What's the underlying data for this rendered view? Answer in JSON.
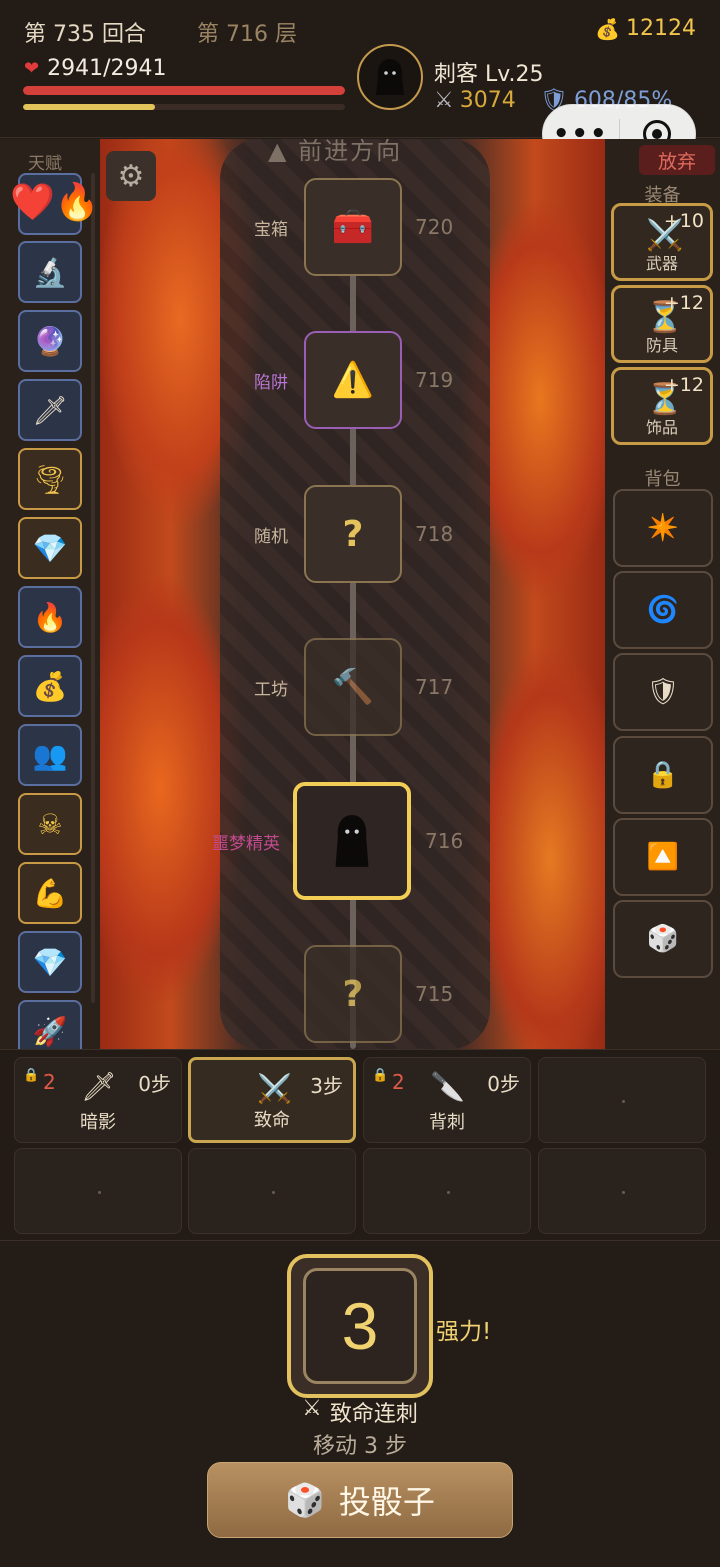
{
  "header": {
    "turn": "第 735 回合",
    "floor": "第 716 层",
    "gold": "12124",
    "hp": "2941/2941",
    "hp_fraction": 1.0,
    "xp_fraction": 0.41,
    "character": "刺客 Lv.25",
    "attack": "3074",
    "crit": "608/85%"
  },
  "left": {
    "title": "天赋",
    "talents": [
      "microscope-icon",
      "crystal-ball-icon",
      "dagger-icon",
      "tornado-icon",
      "diamond-icon",
      "fire-icon",
      "money-bag-icon",
      "shadow-figures-icon",
      "skull-crossbones-icon",
      "dumbbell-icon",
      "diamond-icon",
      "rocket-icon"
    ]
  },
  "map": {
    "route_title": "前进方向",
    "nodes": [
      {
        "label": "宝箱",
        "num": "720",
        "icon": "treasure-chest-icon"
      },
      {
        "label": "陷阱",
        "num": "719",
        "icon": "warning-icon"
      },
      {
        "label": "随机",
        "num": "718",
        "icon": "question-icon",
        "glyph": "?"
      },
      {
        "label": "工坊",
        "num": "717",
        "icon": "hammer-icon"
      },
      {
        "label": "噩梦精英",
        "num": "716",
        "icon": "hooded-assassin-icon"
      },
      {
        "label": "",
        "num": "715",
        "icon": "question-icon",
        "glyph": "?"
      }
    ]
  },
  "right": {
    "give_up": "放弃",
    "equip_title": "装备",
    "equipment": [
      {
        "name": "武器",
        "level": "+10",
        "icon": "crossed-swords-icon"
      },
      {
        "name": "防具",
        "level": "+12",
        "icon": "hourglass-icon"
      },
      {
        "name": "饰品",
        "level": "+12",
        "icon": "hourglass-icon"
      }
    ],
    "bag_title": "背包",
    "bag": [
      "sparkle-icon",
      "swirl-icon",
      "shield-icon",
      "lock-icon",
      "up-arrow-icon",
      "dice-icon"
    ]
  },
  "skills": [
    {
      "count": "2",
      "steps": "0步",
      "name": "暗影",
      "icon": "dagger-icon",
      "locked": true
    },
    {
      "count": "",
      "steps": "3步",
      "name": "致命",
      "icon": "crossed-swords-icon",
      "locked": false
    },
    {
      "count": "2",
      "steps": "0步",
      "name": "背刺",
      "icon": "knife-icon",
      "locked": true
    }
  ],
  "dice": {
    "value": "3",
    "power": "强力!",
    "combo": "致命连刺",
    "move": "移动 3 步",
    "roll_label": "投骰子"
  }
}
